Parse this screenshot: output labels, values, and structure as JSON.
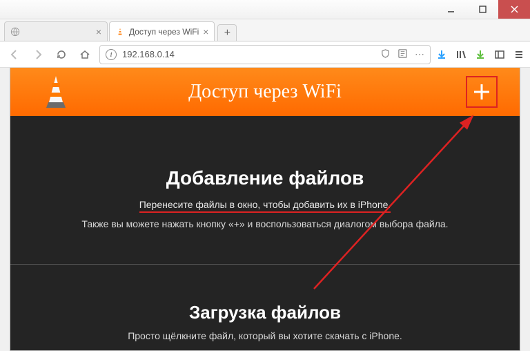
{
  "window": {
    "tab_inactive_placeholder": " ",
    "tab_active_title": "Доступ через WiFi"
  },
  "urlbar": {
    "address": "192.168.0.14"
  },
  "header": {
    "title": "Доступ через WiFi"
  },
  "add_files": {
    "title": "Добавление файлов",
    "line1": "Перенесите файлы в окно, чтобы добавить их в iPhone.",
    "line2": "Также вы можете нажать кнопку «+» и воспользоваться диалогом выбора файла."
  },
  "downloads": {
    "title": "Загрузка файлов",
    "line1": "Просто щёлкните файл, который вы хотите скачать с iPhone."
  }
}
